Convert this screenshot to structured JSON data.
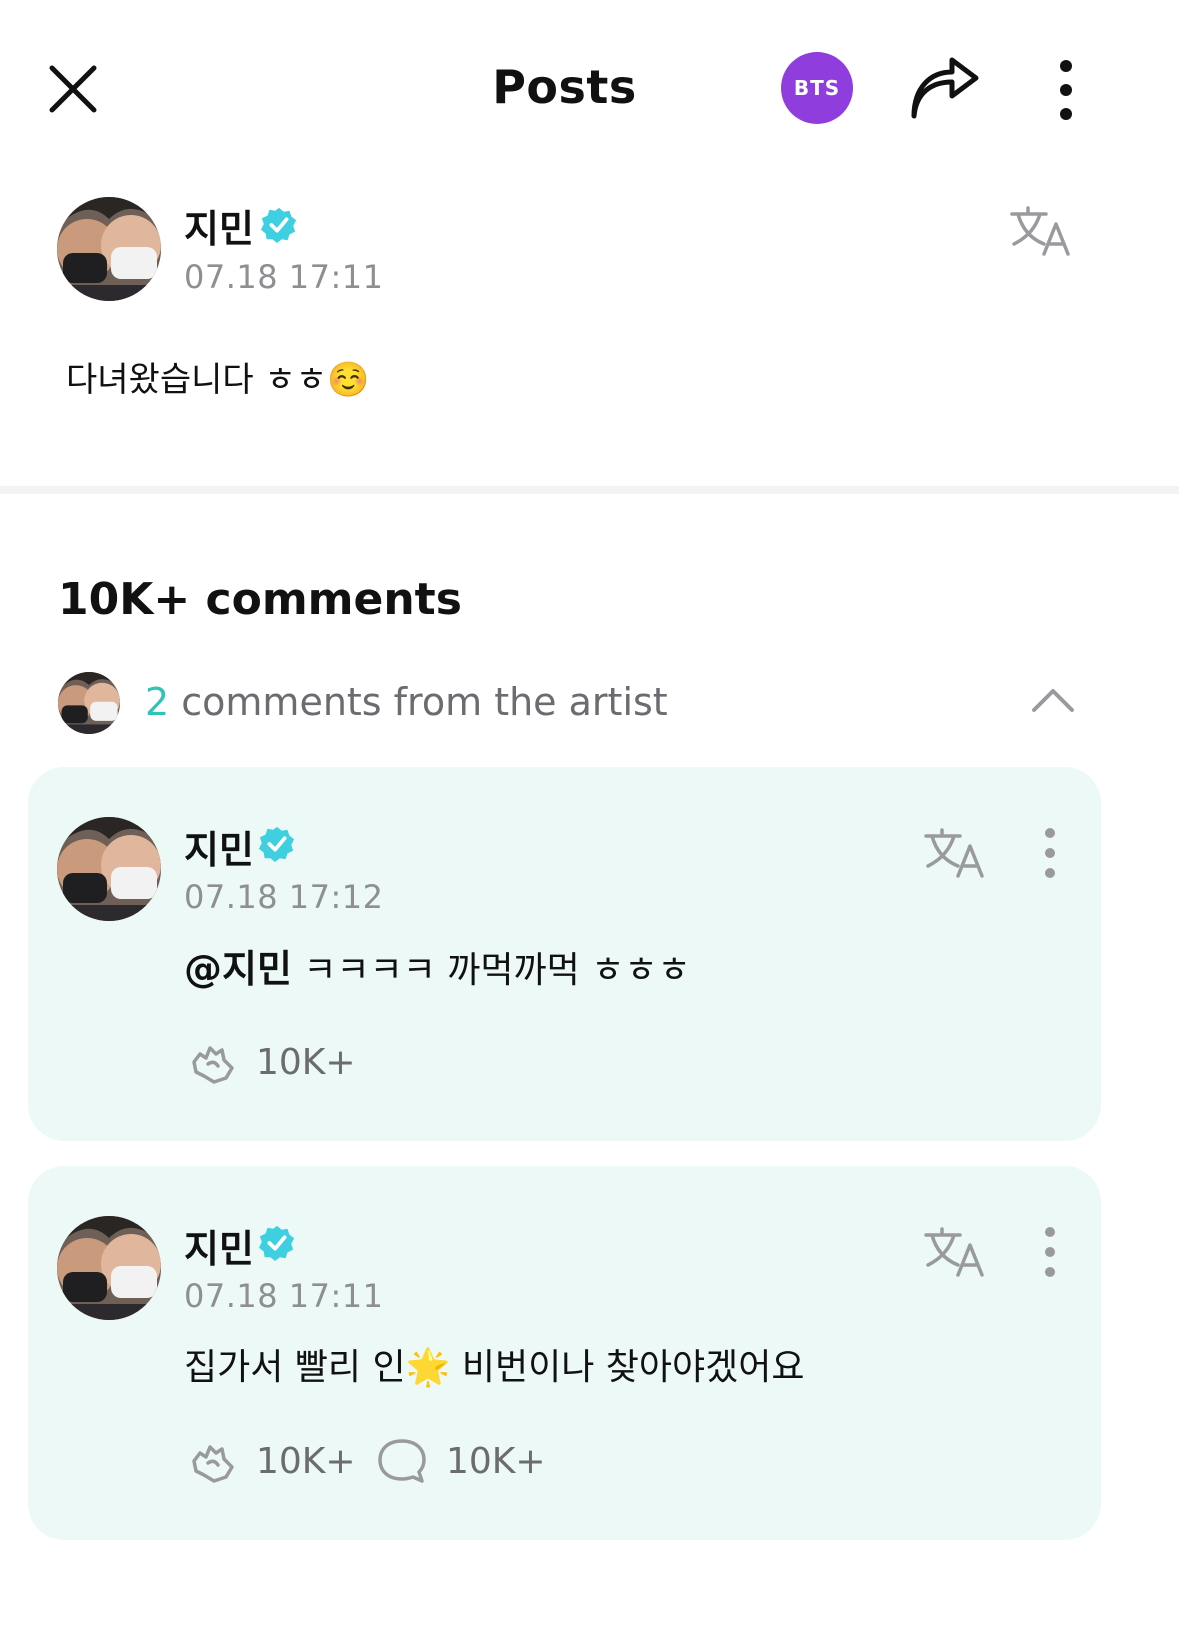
{
  "header": {
    "title": "Posts",
    "community_badge": "BTS",
    "icons": [
      "close-icon",
      "share-icon",
      "more-vertical-icon"
    ]
  },
  "post": {
    "author": "지민",
    "verified": true,
    "timestamp": "07.18 17:11",
    "body": "다녀왔습니다 ㅎㅎ☺️"
  },
  "comments": {
    "count_label": "10K+ comments",
    "artist_comments_count": "2",
    "artist_comments_label": " comments from the artist",
    "items": [
      {
        "author": "지민",
        "timestamp": "07.18 17:12",
        "mention": "@지민",
        "text": " ㅋㅋㅋㅋ 까먹까먹 ㅎㅎㅎ",
        "likes": "10K+"
      },
      {
        "author": "지민",
        "timestamp": "07.18 17:11",
        "text": "집가서 빨리 인🌟 비번이나 찾아야겠어요",
        "likes": "10K+",
        "replies": "10K+"
      }
    ]
  },
  "colors": {
    "accent": "#2fc4b7",
    "badge": "#8f3ddd",
    "card_bg": "#ecf9f7",
    "verified": "#3ecfe0"
  }
}
